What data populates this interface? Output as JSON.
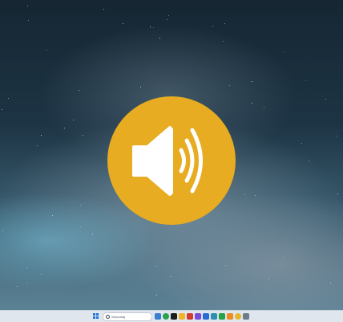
{
  "overlay": {
    "icon": "speaker-volume-icon",
    "color": "#e7ac21"
  },
  "taskbar": {
    "start_icon": "windows-start-icon",
    "search_placeholder": "Wyszukaj",
    "apps": [
      {
        "name": "widgets-icon",
        "color": "#3b7fd1"
      },
      {
        "name": "chat-icon",
        "color": "#2aa24b"
      },
      {
        "name": "media-icon",
        "color": "#1c1c1c"
      },
      {
        "name": "file-explorer-icon",
        "color": "#f0b429"
      },
      {
        "name": "app-red-icon",
        "color": "#d43a2f"
      },
      {
        "name": "browser-icon",
        "color": "#7a4bd6"
      },
      {
        "name": "app-blue-icon",
        "color": "#2c6bd6"
      },
      {
        "name": "app-teal-icon",
        "color": "#2f8fb0"
      },
      {
        "name": "app-green-icon",
        "color": "#29a14a"
      },
      {
        "name": "app-orange-icon",
        "color": "#f08a24"
      },
      {
        "name": "chrome-icon",
        "color": "#e6b62c"
      },
      {
        "name": "app-gray-icon",
        "color": "#6e7c8a"
      }
    ]
  }
}
